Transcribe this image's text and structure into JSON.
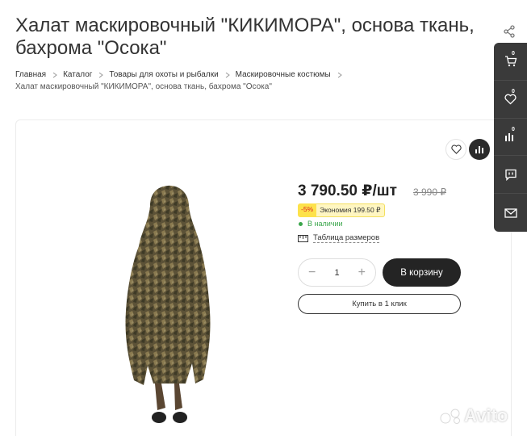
{
  "product": {
    "title": "Халат маскировочный \"КИКИМОРА\", основа ткань, бахрома \"Осока\"",
    "price": "3 790.50 ₽/шт",
    "old_price": "3 990 ₽",
    "discount_pct": "-5%",
    "economy": "Экономия 199.50 ₽",
    "stock": "В наличии",
    "size_table": "Таблица размеров",
    "quantity": "1",
    "add_to_cart": "В корзину",
    "one_click": "Купить в 1 клик"
  },
  "breadcrumbs": {
    "items": [
      "Главная",
      "Каталог",
      "Товары для охоты и рыбалки",
      "Маскировочные костюмы"
    ],
    "current": "Халат маскировочный \"КИКИМОРА\", основа ткань, бахрома \"Осока\""
  },
  "sidebar": {
    "cart_count": "0",
    "fav_count": "0",
    "compare_count": "0"
  },
  "watermark": "Avito",
  "colors": {
    "accent_dark": "#242424",
    "in_stock": "#3aa64b",
    "badge_yellow": "#fde24b",
    "sidebar_bg": "#3a3a3a"
  }
}
